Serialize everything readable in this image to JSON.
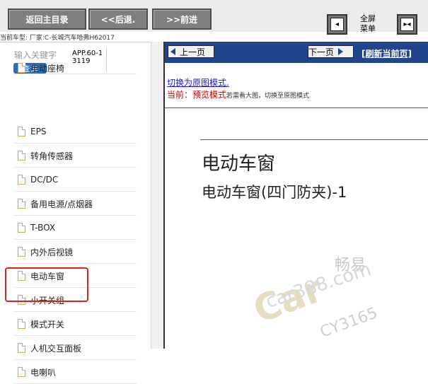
{
  "toolbar": {
    "home_label": "返回主目录",
    "back_label": "<<后退.",
    "forward_label": ">>前进",
    "fullscreen_menu_label": "全屏\n菜单",
    "fullscreen_menu_line1": "全屏",
    "fullscreen_menu_line2": "菜单"
  },
  "car_info": "当前车型:  厂家:C-长城汽车哈弗H62017",
  "search": {
    "placeholder": "输入关键字",
    "query_label": "查询",
    "app_id": "APP.60-13119"
  },
  "sidebar": {
    "items": [
      {
        "label": "电动座椅"
      },
      {
        "label": "EPS"
      },
      {
        "label": "转角传感器"
      },
      {
        "label": "DC/DC"
      },
      {
        "label": "备用电源/点烟器"
      },
      {
        "label": "T-BOX"
      },
      {
        "label": "内外后视镜"
      },
      {
        "label": "电动车窗"
      },
      {
        "label": "小开关组"
      },
      {
        "label": "模式开关"
      },
      {
        "label": "人机交互面板"
      },
      {
        "label": "电喇叭"
      }
    ],
    "highlighted_index": 7,
    "highlight_color": "#e02020"
  },
  "viewer": {
    "prev_label": "上一页",
    "next_label": "下一页",
    "refresh_label": "[刷新当前页]",
    "switch_link": "切换为原图模式.",
    "current_label": "当前：",
    "current_mode": "预览模式",
    "current_hint": "若需看大图，切换至原图模式",
    "doc_title": "电动车窗",
    "doc_subtitle": "电动车窗(四门防夹)-1",
    "toolbar_color": "#21458a"
  },
  "watermark": {
    "cn": "畅易",
    "site": "car388.com",
    "big": "Car",
    "code": "CY3165"
  }
}
